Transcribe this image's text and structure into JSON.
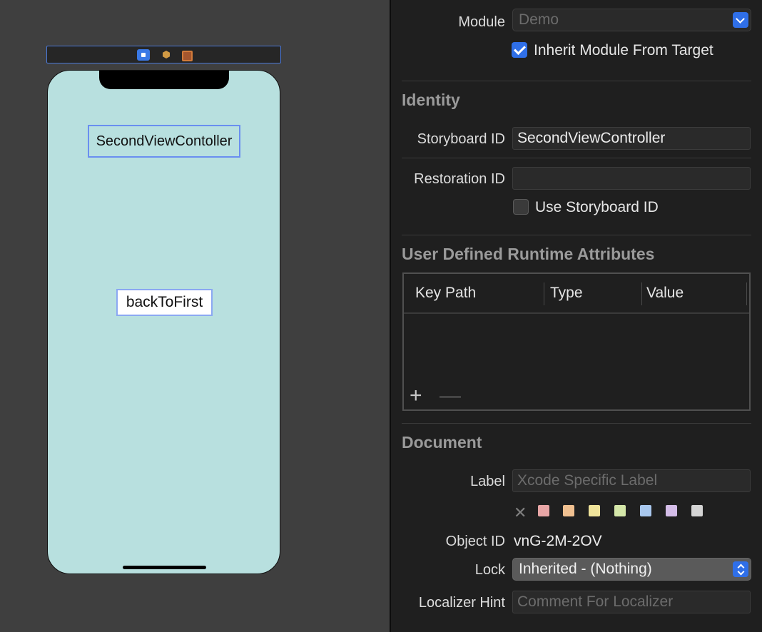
{
  "canvas": {
    "scene_icons": [
      "view-controller-icon",
      "first-responder-icon",
      "exit-icon"
    ],
    "screen": {
      "title_label": "SecondViewContoller",
      "button_label": "backToFirst",
      "background_color": "#b8e0df"
    }
  },
  "inspector": {
    "module": {
      "label": "Module",
      "value": "Demo",
      "inherit_checkbox_label": "Inherit Module From Target",
      "inherit_checked": true
    },
    "identity": {
      "title": "Identity",
      "storyboard_id_label": "Storyboard ID",
      "storyboard_id_value": "SecondViewController",
      "restoration_id_label": "Restoration ID",
      "restoration_id_value": "",
      "use_storyboard_id_label": "Use Storyboard ID",
      "use_storyboard_id_checked": false
    },
    "runtime_attributes": {
      "title": "User Defined Runtime Attributes",
      "columns": [
        "Key Path",
        "Type",
        "Value"
      ],
      "add_label": "+",
      "remove_label": "—"
    },
    "document": {
      "title": "Document",
      "label_label": "Label",
      "label_placeholder": "Xcode Specific Label",
      "clear_label": "✕",
      "colors": [
        "#e8a6a6",
        "#f0c090",
        "#efe39a",
        "#d4e6a8",
        "#a9c8ee",
        "#d4bde8",
        "#d4d4d4"
      ],
      "object_id_label": "Object ID",
      "object_id_value": "vnG-2M-2OV",
      "lock_label": "Lock",
      "lock_value": "Inherited - (Nothing)",
      "localizer_hint_label": "Localizer Hint",
      "localizer_hint_placeholder": "Comment For Localizer"
    }
  }
}
